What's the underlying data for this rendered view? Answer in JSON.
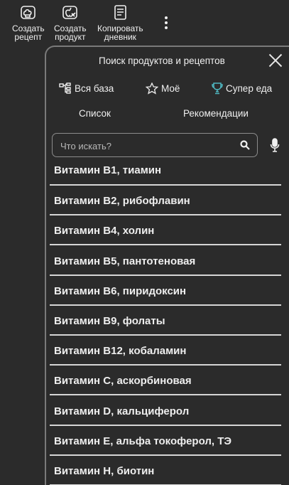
{
  "toolbar": {
    "items": [
      {
        "label": "Создать\nрецепт",
        "icon": "chef-hat-icon"
      },
      {
        "label": "Создать\nпродукт",
        "icon": "apple-icon"
      },
      {
        "label": "Копировать\nдневник",
        "icon": "document-copy-icon"
      }
    ],
    "more_icon": "more-vertical-icon"
  },
  "panel": {
    "title": "Поиск продуктов и рецептов",
    "filters": [
      "Вся база",
      "Моё",
      "Супер еда"
    ],
    "tabs": [
      "Список",
      "Рекомендации"
    ],
    "search_placeholder": "Что искать?"
  },
  "list": [
    "Витамин B1, тиамин",
    "Витамин B2, рибофлавин",
    "Витамин B4, холин",
    "Витамин B5, пантотеновая",
    "Витамин B6, пиридоксин",
    "Витамин B9, фолаты",
    "Витамин B12, кобаламин",
    "Витамин C, аскорбиновая",
    "Витамин D, кальциферол",
    "Витамин E, альфа токоферол, ТЭ",
    "Витамин H, биотин"
  ],
  "colors": {
    "background": "#2b2b2b",
    "accent": "#4fb8c2",
    "divider": "#d6d6d6"
  }
}
